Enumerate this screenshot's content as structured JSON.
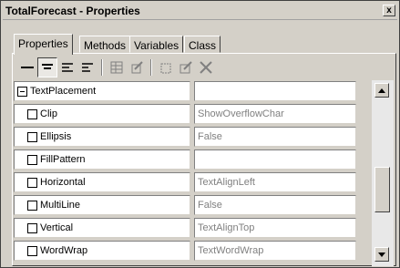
{
  "window": {
    "title": "TotalForecast - Properties",
    "close_glyph": "x"
  },
  "tabs": [
    {
      "label": "Properties",
      "active": true
    },
    {
      "label": "Methods",
      "active": false
    },
    {
      "label": "Variables",
      "active": false
    },
    {
      "label": "Class",
      "active": false
    }
  ],
  "toolbar": {
    "icons": [
      "line-icon",
      "align-center-icon",
      "align-left-icon",
      "align-left-alt-icon",
      "grid-icon",
      "edit-icon",
      "new-icon",
      "edit-doc-icon",
      "delete-x-icon"
    ],
    "pressed": "align-center-icon"
  },
  "properties": {
    "group": {
      "name": "TextPlacement",
      "value": "",
      "expanded": true
    },
    "items": [
      {
        "name": "Clip",
        "value": "ShowOverflowChar"
      },
      {
        "name": "Ellipsis",
        "value": "False"
      },
      {
        "name": "FillPattern",
        "value": ""
      },
      {
        "name": "Horizontal",
        "value": "TextAlignLeft"
      },
      {
        "name": "MultiLine",
        "value": "False"
      },
      {
        "name": "Vertical",
        "value": "TextAlignTop"
      },
      {
        "name": "WordWrap",
        "value": "TextWordWrap"
      }
    ]
  }
}
